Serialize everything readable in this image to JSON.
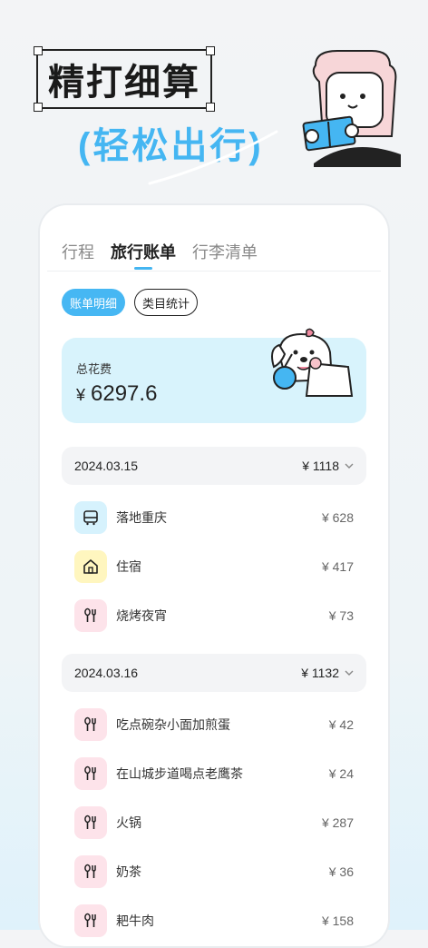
{
  "hero": {
    "title": "精打细算",
    "subtitle": "(轻松出行)"
  },
  "tabs": [
    {
      "label": "行程"
    },
    {
      "label": "旅行账单"
    },
    {
      "label": "行李清单"
    }
  ],
  "segments": {
    "detail": "账单明细",
    "stats": "类目统计"
  },
  "total": {
    "label": "总花费",
    "currency": "¥",
    "value": "6297.6"
  },
  "days": [
    {
      "date": "2024.03.15",
      "total": "¥ 1118",
      "items": [
        {
          "name": "落地重庆",
          "amount": "¥ 628",
          "icon": "bus-icon"
        },
        {
          "name": "住宿",
          "amount": "¥ 417",
          "icon": "house-icon"
        },
        {
          "name": "烧烤夜宵",
          "amount": "¥ 73",
          "icon": "utensils-icon"
        }
      ]
    },
    {
      "date": "2024.03.16",
      "total": "¥ 1132",
      "items": [
        {
          "name": "吃点碗杂小面加煎蛋",
          "amount": "¥ 42",
          "icon": "utensils-icon"
        },
        {
          "name": "在山城步道喝点老鹰茶",
          "amount": "¥ 24",
          "icon": "utensils-icon"
        },
        {
          "name": "火锅",
          "amount": "¥ 287",
          "icon": "utensils-icon"
        },
        {
          "name": "奶茶",
          "amount": "¥ 36",
          "icon": "utensils-icon"
        },
        {
          "name": "耙牛肉",
          "amount": "¥ 158",
          "icon": "utensils-icon"
        }
      ]
    }
  ],
  "colors": {
    "accent": "#46b7f3",
    "total_bg": "#d8f3fc",
    "food_bg": "#fde3ea",
    "stay_bg": "#fff6bf",
    "transport_bg": "#d6f2fd"
  }
}
